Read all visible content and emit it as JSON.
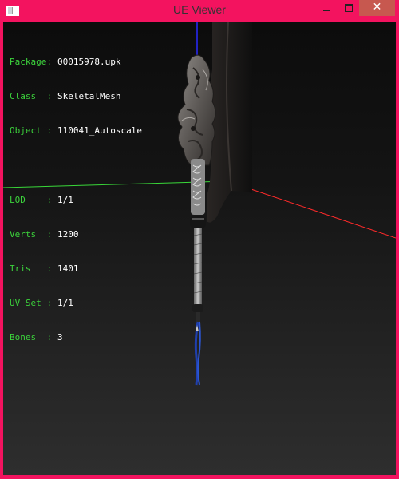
{
  "window": {
    "title": "UE Viewer",
    "controls": {
      "minimize_glyph": "–",
      "maximize_glyph": "□",
      "close_glyph": "✕"
    },
    "icon": "app-window-icon"
  },
  "hud": {
    "group1": [
      {
        "key": "Package:",
        "value": "00015978.upk"
      },
      {
        "key": "Class  :",
        "value": "SkeletalMesh"
      },
      {
        "key": "Object :",
        "value": "110041_Autoscale"
      }
    ],
    "group2": [
      {
        "key": "LOD    :",
        "value": "1/1"
      },
      {
        "key": "Verts  :",
        "value": "1200"
      },
      {
        "key": "Tris   :",
        "value": "1401"
      },
      {
        "key": "UV Set :",
        "value": "1/1"
      },
      {
        "key": "Bones  :",
        "value": "3"
      }
    ]
  },
  "scene": {
    "colors": {
      "x_axis": "#ff2a2a",
      "y_axis": "#39d739",
      "z_axis": "#2a2aff",
      "hud_key": "#3cd33c",
      "hud_value": "#ffffff"
    },
    "mesh": "ornate-glaive-weapon"
  }
}
